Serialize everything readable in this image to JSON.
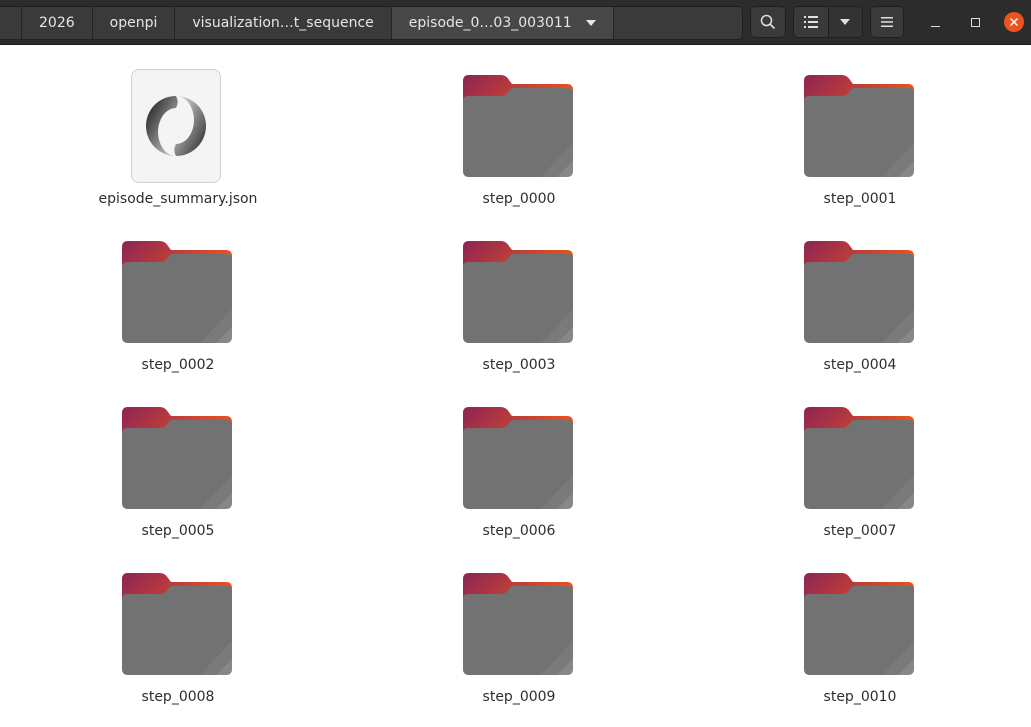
{
  "pathbar": {
    "crumbs": [
      "2026",
      "openpi",
      "visualization…t_sequence"
    ],
    "current": "episode_0…03_003011"
  },
  "toolbar": {
    "search": "search-icon",
    "view_list": "list-view-icon",
    "view_options": "chevron-down-icon",
    "menu": "hamburger-menu-icon"
  },
  "window": {
    "minimize": "minimize-icon",
    "maximize": "maximize-icon",
    "close": "close-icon",
    "close_color": "#e95420"
  },
  "files": [
    {
      "name": "episode_summary.json",
      "type": "json"
    },
    {
      "name": "step_0000",
      "type": "folder"
    },
    {
      "name": "step_0001",
      "type": "folder"
    },
    {
      "name": "step_0002",
      "type": "folder"
    },
    {
      "name": "step_0003",
      "type": "folder"
    },
    {
      "name": "step_0004",
      "type": "folder"
    },
    {
      "name": "step_0005",
      "type": "folder"
    },
    {
      "name": "step_0006",
      "type": "folder"
    },
    {
      "name": "step_0007",
      "type": "folder"
    },
    {
      "name": "step_0008",
      "type": "folder"
    },
    {
      "name": "step_0009",
      "type": "folder"
    },
    {
      "name": "step_0010",
      "type": "folder"
    }
  ],
  "colors": {
    "folder_body": "#727272",
    "folder_tab_start": "#8c2455",
    "folder_tab_end": "#e9541f",
    "headerbar": "#2c2c2c"
  }
}
